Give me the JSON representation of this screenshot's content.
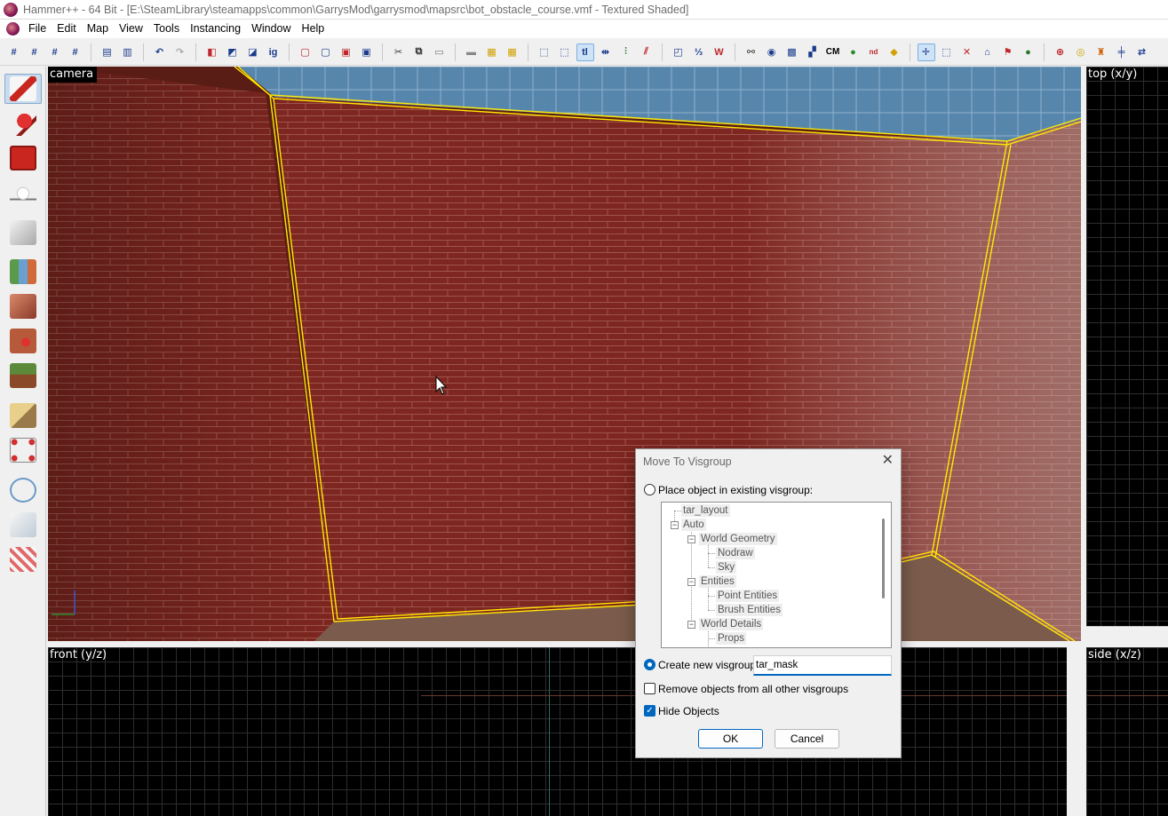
{
  "window": {
    "title": "Hammer++ - 64 Bit - [E:\\SteamLibrary\\steamapps\\common\\GarrysMod\\garrysmod\\mapsrc\\bot_obstacle_course.vmf - Textured Shaded]"
  },
  "menubar": {
    "items": [
      "File",
      "Edit",
      "Map",
      "View",
      "Tools",
      "Instancing",
      "Window",
      "Help"
    ]
  },
  "toolbar": {
    "groups": [
      [
        "grid-toggle-icon",
        "grid-smaller-icon",
        "grid-larger-icon",
        "grid-3d-icon"
      ],
      [
        "group-icon",
        "ungroup-icon"
      ],
      [
        "undo-icon",
        "redo-icon"
      ],
      [
        "carve-icon",
        "hollow-icon",
        "texture-lock-icon",
        "select-icon"
      ],
      [
        "brush-1-icon",
        "brush-2-icon",
        "brush-3-icon",
        "brush-4-icon"
      ],
      [
        "cut-icon",
        "copy-icon",
        "paste-icon"
      ],
      [
        "hide-icon",
        "texture-1-icon",
        "texture-2-icon"
      ],
      [
        "selection-box-icon",
        "select-mode-icon",
        "tl-icon",
        "tl2-icon",
        "align-icon",
        "flip-icon"
      ],
      [
        "entity-report-icon",
        "compile-icon",
        "run-map-icon"
      ],
      [
        "visgroup-1-icon",
        "visgroup-2-icon",
        "visgroup-3-icon",
        "visgroup-4-icon",
        "cm-icon",
        "leaf-icon",
        "nodraw-icon",
        "shield-icon"
      ],
      [
        "move-icon",
        "box-icon",
        "delete-icon",
        "tool-a-icon",
        "tool-b-icon",
        "tool-c-icon"
      ],
      [
        "sphere-icon",
        "light-icon",
        "bucket-icon",
        "cross-icon",
        "arrows-icon"
      ]
    ],
    "tl_label": "tl",
    "cm_label": "CM"
  },
  "palette": {
    "items": [
      {
        "name": "selection-tool-icon",
        "color": "#c8261f",
        "active": true
      },
      {
        "name": "magnify-tool-icon",
        "color": "#c8261f",
        "active": false
      },
      {
        "name": "camera-tool-icon",
        "color": "#c8261f",
        "active": false
      },
      {
        "name": "entity-tool-icon",
        "color": "#d9d9d9",
        "active": false
      },
      {
        "name": "block-tool-icon",
        "color": "#cfcfcf",
        "active": false
      },
      {
        "name": "texture-tool-icon",
        "color": "#6aa0d0",
        "active": false
      },
      {
        "name": "apply-texture-tool-icon",
        "color": "#b65a3a",
        "active": false
      },
      {
        "name": "decal-tool-icon",
        "color": "#b65a3a",
        "active": false
      },
      {
        "name": "overlay-tool-icon",
        "color": "#5c8a3a",
        "active": false
      },
      {
        "name": "clip-tool-icon",
        "color": "#d8b66c",
        "active": false
      },
      {
        "name": "vertex-tool-icon",
        "color": "#d03030",
        "active": false
      },
      {
        "name": "path-tool-icon",
        "color": "#6a9ac8",
        "active": false
      },
      {
        "name": "sprinkle-tool-icon",
        "color": "#9ab8d0",
        "active": false
      },
      {
        "name": "instance-tool-icon",
        "color": "#d77a7a",
        "active": false
      }
    ]
  },
  "viewports": {
    "camera_label": "camera",
    "top_label": "top (x/y)",
    "front_label": "front (y/z)",
    "side_label": "side (x/z)"
  },
  "colors": {
    "selection_outline": "#ffea00",
    "brick_center": "#8b2a22",
    "sky": "#4b7ea8",
    "grid_line": "#2d2d2d",
    "accent": "#0067c0"
  },
  "dialog": {
    "title": "Move To Visgroup",
    "option_existing": "Place object in existing visgroup:",
    "tree": [
      {
        "label": "tar_layout",
        "level": 0
      },
      {
        "label": "Auto",
        "level": 0
      },
      {
        "label": "World Geometry",
        "level": 1
      },
      {
        "label": "Nodraw",
        "level": 2
      },
      {
        "label": "Sky",
        "level": 2
      },
      {
        "label": "Entities",
        "level": 1
      },
      {
        "label": "Point Entities",
        "level": 2
      },
      {
        "label": "Brush Entities",
        "level": 2
      },
      {
        "label": "World Details",
        "level": 1
      },
      {
        "label": "Props",
        "level": 2
      }
    ],
    "option_new": "Create new visgroup:",
    "new_visgroup_value": "tar_mask",
    "option_existing_selected": false,
    "option_new_selected": true,
    "remove_label": "Remove objects from all other visgroups",
    "remove_checked": false,
    "hide_label": "Hide Objects",
    "hide_checked": true,
    "ok_label": "OK",
    "cancel_label": "Cancel"
  }
}
